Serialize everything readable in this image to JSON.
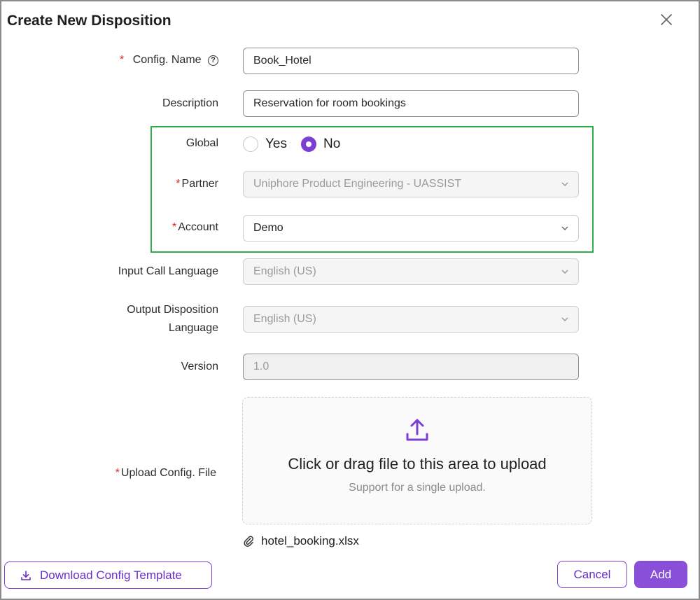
{
  "dialog": {
    "title": "Create New Disposition",
    "close_icon": "close-icon"
  },
  "form": {
    "config_name": {
      "label": "Config. Name",
      "required": "*",
      "value": "Book_Hotel",
      "help_icon": "question-circle-icon"
    },
    "description": {
      "label": "Description",
      "value": "Reservation for room bookings"
    },
    "global": {
      "label": "Global",
      "options": [
        "Yes",
        "No"
      ],
      "selected": "No"
    },
    "partner": {
      "label": "Partner",
      "required": "*",
      "value": "Uniphore Product Engineering - UASSIST",
      "disabled": true
    },
    "account": {
      "label": "Account",
      "required": "*",
      "value": "Demo"
    },
    "input_call_language": {
      "label": "Input Call Language",
      "value": "English (US)",
      "disabled": true
    },
    "output_disposition_language": {
      "label_line1": "Output Disposition",
      "label_line2": "Language",
      "value": "English (US)",
      "disabled": true
    },
    "version": {
      "label": "Version",
      "value": "1.0",
      "disabled": true
    },
    "upload": {
      "label": "Upload Config. File",
      "required": "*",
      "title": "Click or drag file to this area to upload",
      "hint": "Support for a single upload.",
      "icon": "upload-icon"
    },
    "attached_file": {
      "name": "hotel_booking.xlsx",
      "icon": "paperclip-icon"
    }
  },
  "footer": {
    "download_label": "Download Config Template",
    "download_icon": "download-icon",
    "cancel_label": "Cancel",
    "add_label": "Add"
  },
  "colors": {
    "accent": "#7b3fd3",
    "primary_button": "#8a4fd8",
    "required": "#e02424",
    "highlight_border": "#2bb04a"
  }
}
